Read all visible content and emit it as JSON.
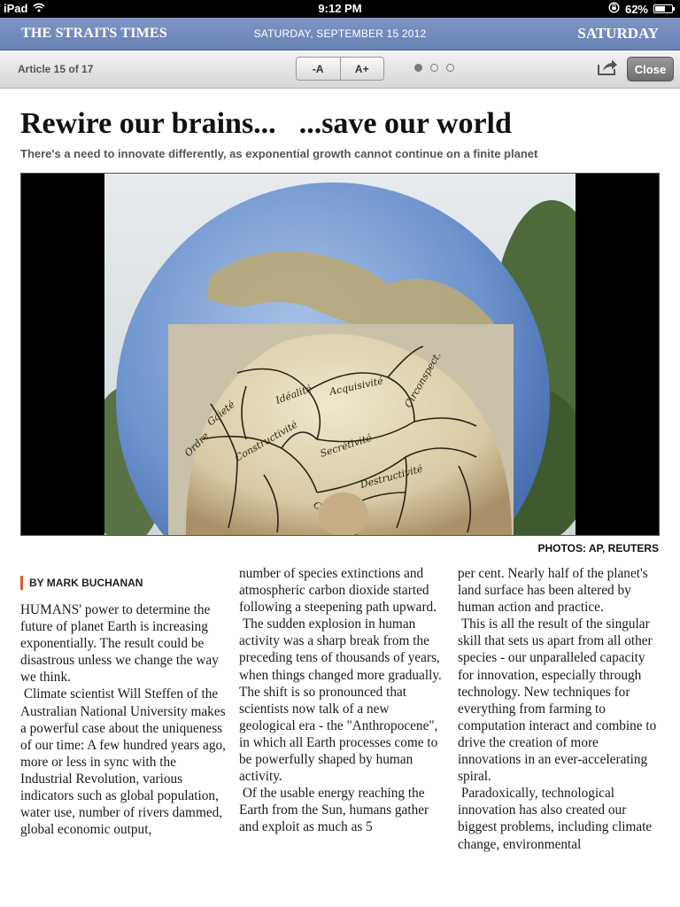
{
  "status_bar": {
    "device": "iPad",
    "time": "9:12 PM",
    "battery": "62%",
    "battery_level": 0.62
  },
  "masthead": {
    "paper": "THE STRAITS TIMES",
    "date": "SATURDAY, SEPTEMBER 15 2012",
    "day": "SATURDAY"
  },
  "toolbar": {
    "article_count": "Article 15 of 17",
    "font_decrease": "-A",
    "font_increase": "A+",
    "page_dots_active": 0,
    "share_icon": "share-icon",
    "close": "Close"
  },
  "article": {
    "headline_part1": "Rewire our brains...",
    "headline_part2": "...save our world",
    "subhead": "There's a need to innovate differently, as exponential growth cannot continue on a finite planet",
    "photo_credit": "PHOTOS: AP, REUTERS",
    "byline": "BY MARK BUCHANAN",
    "col1": [
      "HUMANS' power to determine the future of planet Earth is increasing exponentially. The result could be disastrous unless we change the way we think.",
      " Climate scientist Will Steffen of the Australian National University makes a powerful case about the uniqueness of our time: A few hundred years ago, more or less in sync with the Industrial Revolution, various indicators such as global population, water use, number of rivers dammed, global economic output,"
    ],
    "col2": [
      "number of species extinctions and atmospheric carbon dioxide started following a steepening path upward.",
      " The sudden explosion in human activity was a sharp break from the preceding tens of thousands of years, when things changed more gradually. The shift is so pronounced that scientists now talk of a new geological era - the \"Anthropocene\", in which all Earth processes come to be powerfully shaped by human activity.",
      " Of the usable energy reaching the Earth from the Sun, humans gather and exploit as much as 5"
    ],
    "col3": [
      "per cent. Nearly half of the planet's land surface has been altered by human action and practice.",
      " This is all the result of the singular skill that sets us apart from all other species - our unparalleled capacity for innovation, especially through technology. New techniques for everything from farming to computation interact and combine to drive the creation of more innovations in an ever-accelerating spiral.",
      " Paradoxically, technological innovation has also created our biggest problems, including climate change, environmental"
    ]
  },
  "colors": {
    "masthead_bg": "#7489bd",
    "byline_accent": "#e0582a",
    "close_button": "#808080"
  }
}
